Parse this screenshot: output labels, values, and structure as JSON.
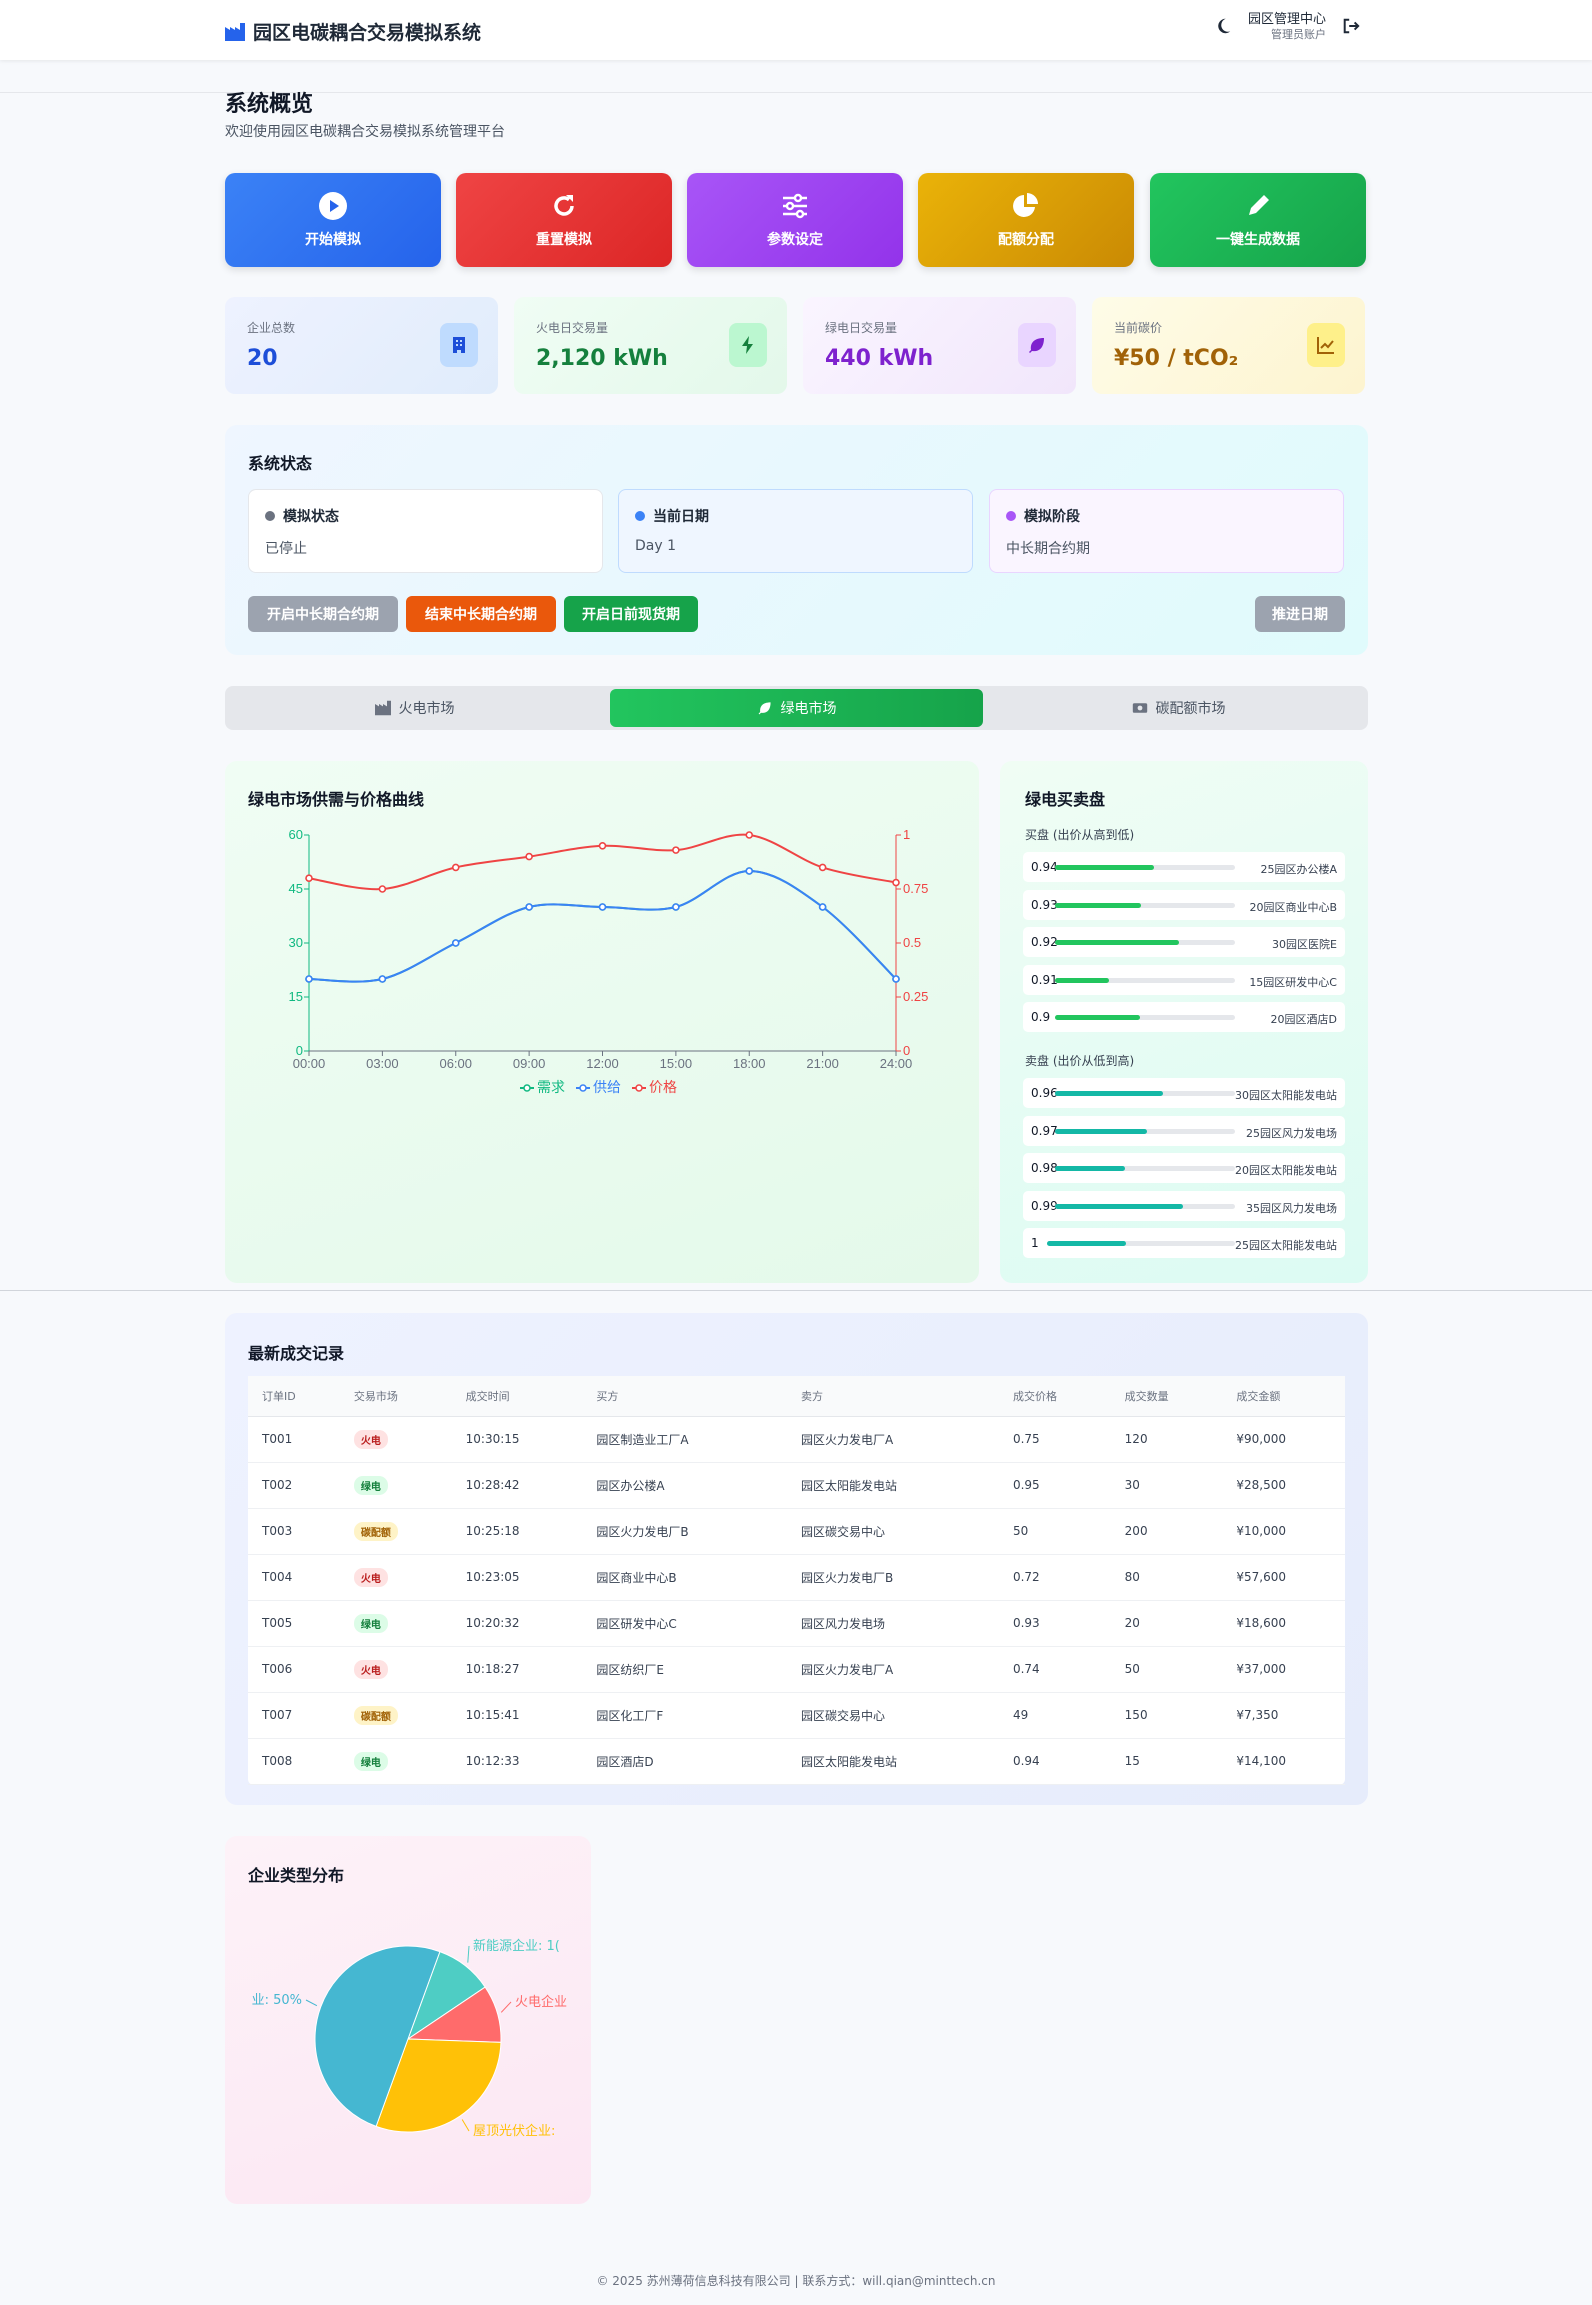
{
  "header": {
    "title": "园区电碳耦合交易模拟系统",
    "user_name": "园区管理中心",
    "user_role": "管理员账户"
  },
  "page": {
    "title": "系统概览",
    "subtitle": "欢迎使用园区电碳耦合交易模拟系统管理平台"
  },
  "actions": [
    {
      "label": "开始模拟",
      "icon": "play-icon",
      "color": "#2563eb"
    },
    {
      "label": "重置模拟",
      "icon": "refresh-icon",
      "color": "#dc2626"
    },
    {
      "label": "参数设定",
      "icon": "sliders-icon",
      "color": "#9333ea"
    },
    {
      "label": "配额分配",
      "icon": "pie-icon",
      "color": "#ca8a04"
    },
    {
      "label": "一键生成数据",
      "icon": "pen-icon",
      "color": "#16a34a"
    }
  ],
  "stats": [
    {
      "label": "企业总数",
      "value": "20",
      "icon": "building-icon",
      "color": "#1d4ed8"
    },
    {
      "label": "火电日交易量",
      "value": "2,120 kWh",
      "icon": "bolt-icon",
      "color": "#15803d"
    },
    {
      "label": "绿电日交易量",
      "value": "440 kWh",
      "icon": "leaf-icon",
      "color": "#7e22ce"
    },
    {
      "label": "当前碳价",
      "value": "¥50 / tCO₂",
      "icon": "chart-line-icon",
      "color": "#a16207"
    }
  ],
  "system_status": {
    "title": "系统状态",
    "cards": [
      {
        "label": "模拟状态",
        "value": "已停止",
        "dot_color": "#6b7280"
      },
      {
        "label": "当前日期",
        "value": "Day 1",
        "dot_color": "#3b82f6"
      },
      {
        "label": "模拟阶段",
        "value": "中长期合约期",
        "dot_color": "#a855f7"
      }
    ],
    "buttons": {
      "start_long_term": "开启中长期合约期",
      "end_long_term": "结束中长期合约期",
      "start_spot": "开启日前现货期",
      "advance_day": "推进日期"
    }
  },
  "tabs": [
    {
      "label": "火电市场",
      "icon": "factory-icon"
    },
    {
      "label": "绿电市场",
      "icon": "leaf-icon"
    },
    {
      "label": "碳配额市场",
      "icon": "money-icon"
    }
  ],
  "chart_data": [
    {
      "type": "line",
      "title": "绿电市场供需与价格曲线",
      "x": [
        "00:00",
        "03:00",
        "06:00",
        "09:00",
        "12:00",
        "15:00",
        "18:00",
        "21:00",
        "24:00"
      ],
      "ylim": [
        0,
        60
      ],
      "y_ticks": [
        "0",
        "15",
        "30",
        "45",
        "60"
      ],
      "y2lim": [
        0,
        1
      ],
      "y2_ticks": [
        "0",
        "0.25",
        "0.5",
        "0.75",
        "1"
      ],
      "series": [
        {
          "name": "需求",
          "axis": "left",
          "color": "#10b981",
          "values": [
            20,
            20,
            30,
            40,
            40,
            40,
            50,
            40,
            20
          ]
        },
        {
          "name": "供给",
          "axis": "left",
          "color": "#3b82f6",
          "values": [
            20,
            20,
            30,
            40,
            40,
            40,
            50,
            40,
            20
          ]
        },
        {
          "name": "价格",
          "axis": "right",
          "color": "#ef4444",
          "values": [
            0.8,
            0.75,
            0.85,
            0.9,
            0.95,
            0.93,
            1.0,
            0.85,
            0.78
          ]
        }
      ]
    },
    {
      "type": "pie",
      "title": "企业类型分布",
      "slices": [
        {
          "label": "新能源企业: 1(",
          "value": 10,
          "color": "#4ecdc4"
        },
        {
          "label": "火电企业",
          "value": 10,
          "color": "#ff6b6b"
        },
        {
          "label": "屋顶光伏企业:",
          "value": 30,
          "color": "#ffc107"
        },
        {
          "label": "业: 50%",
          "value": 50,
          "color": "#45b7d1"
        }
      ]
    }
  ],
  "orderbook": {
    "title": "绿电买卖盘",
    "buy_title": "买盘 (出价从高到低)",
    "sell_title": "卖盘 (出价从低到高)",
    "buy": [
      {
        "price": "0.94",
        "text": "25园区办公楼A",
        "fill": 0.55
      },
      {
        "price": "0.93",
        "text": "20园区商业中心B",
        "fill": 0.48
      },
      {
        "price": "0.92",
        "text": "30园区医院E",
        "fill": 0.69
      },
      {
        "price": "0.91",
        "text": "15园区研发中心C",
        "fill": 0.3
      },
      {
        "price": "0.9",
        "text": "20园区酒店D",
        "fill": 0.47
      }
    ],
    "sell": [
      {
        "price": "0.96",
        "text": "30园区太阳能发电站",
        "fill": 0.6
      },
      {
        "price": "0.97",
        "text": "25园区风力发电场",
        "fill": 0.51
      },
      {
        "price": "0.98",
        "text": "20园区太阳能发电站",
        "fill": 0.39
      },
      {
        "price": "0.99",
        "text": "35园区风力发电场",
        "fill": 0.71
      },
      {
        "price": "1",
        "text": "25园区太阳能发电站",
        "fill": 0.42
      }
    ]
  },
  "trades": {
    "title": "最新成交记录",
    "columns": [
      "订单ID",
      "交易市场",
      "成交时间",
      "买方",
      "卖方",
      "成交价格",
      "成交数量",
      "成交金额"
    ],
    "rows": [
      {
        "id": "T001",
        "market": "火电",
        "time": "10:30:15",
        "buyer": "园区制造业工厂A",
        "seller": "园区火力发电厂A",
        "price": "0.75",
        "qty": "120",
        "amount": "¥90,000"
      },
      {
        "id": "T002",
        "market": "绿电",
        "time": "10:28:42",
        "buyer": "园区办公楼A",
        "seller": "园区太阳能发电站",
        "price": "0.95",
        "qty": "30",
        "amount": "¥28,500"
      },
      {
        "id": "T003",
        "market": "碳配额",
        "time": "10:25:18",
        "buyer": "园区火力发电厂B",
        "seller": "园区碳交易中心",
        "price": "50",
        "qty": "200",
        "amount": "¥10,000"
      },
      {
        "id": "T004",
        "market": "火电",
        "time": "10:23:05",
        "buyer": "园区商业中心B",
        "seller": "园区火力发电厂B",
        "price": "0.72",
        "qty": "80",
        "amount": "¥57,600"
      },
      {
        "id": "T005",
        "market": "绿电",
        "time": "10:20:32",
        "buyer": "园区研发中心C",
        "seller": "园区风力发电场",
        "price": "0.93",
        "qty": "20",
        "amount": "¥18,600"
      },
      {
        "id": "T006",
        "market": "火电",
        "time": "10:18:27",
        "buyer": "园区纺织厂E",
        "seller": "园区火力发电厂A",
        "price": "0.74",
        "qty": "50",
        "amount": "¥37,000"
      },
      {
        "id": "T007",
        "market": "碳配额",
        "time": "10:15:41",
        "buyer": "园区化工厂F",
        "seller": "园区碳交易中心",
        "price": "49",
        "qty": "150",
        "amount": "¥7,350"
      },
      {
        "id": "T008",
        "market": "绿电",
        "time": "10:12:33",
        "buyer": "园区酒店D",
        "seller": "园区太阳能发电站",
        "price": "0.94",
        "qty": "15",
        "amount": "¥14,100"
      }
    ]
  },
  "market_tag_colors": {
    "火电": {
      "bg": "#fee2e2",
      "fg": "#b91c1c"
    },
    "绿电": {
      "bg": "#dcfce7",
      "fg": "#15803d"
    },
    "碳配额": {
      "bg": "#fef3c7",
      "fg": "#a16207"
    }
  },
  "footer": "© 2025 苏州薄荷信息科技有限公司 | 联系方式：will.qian@minttech.cn"
}
